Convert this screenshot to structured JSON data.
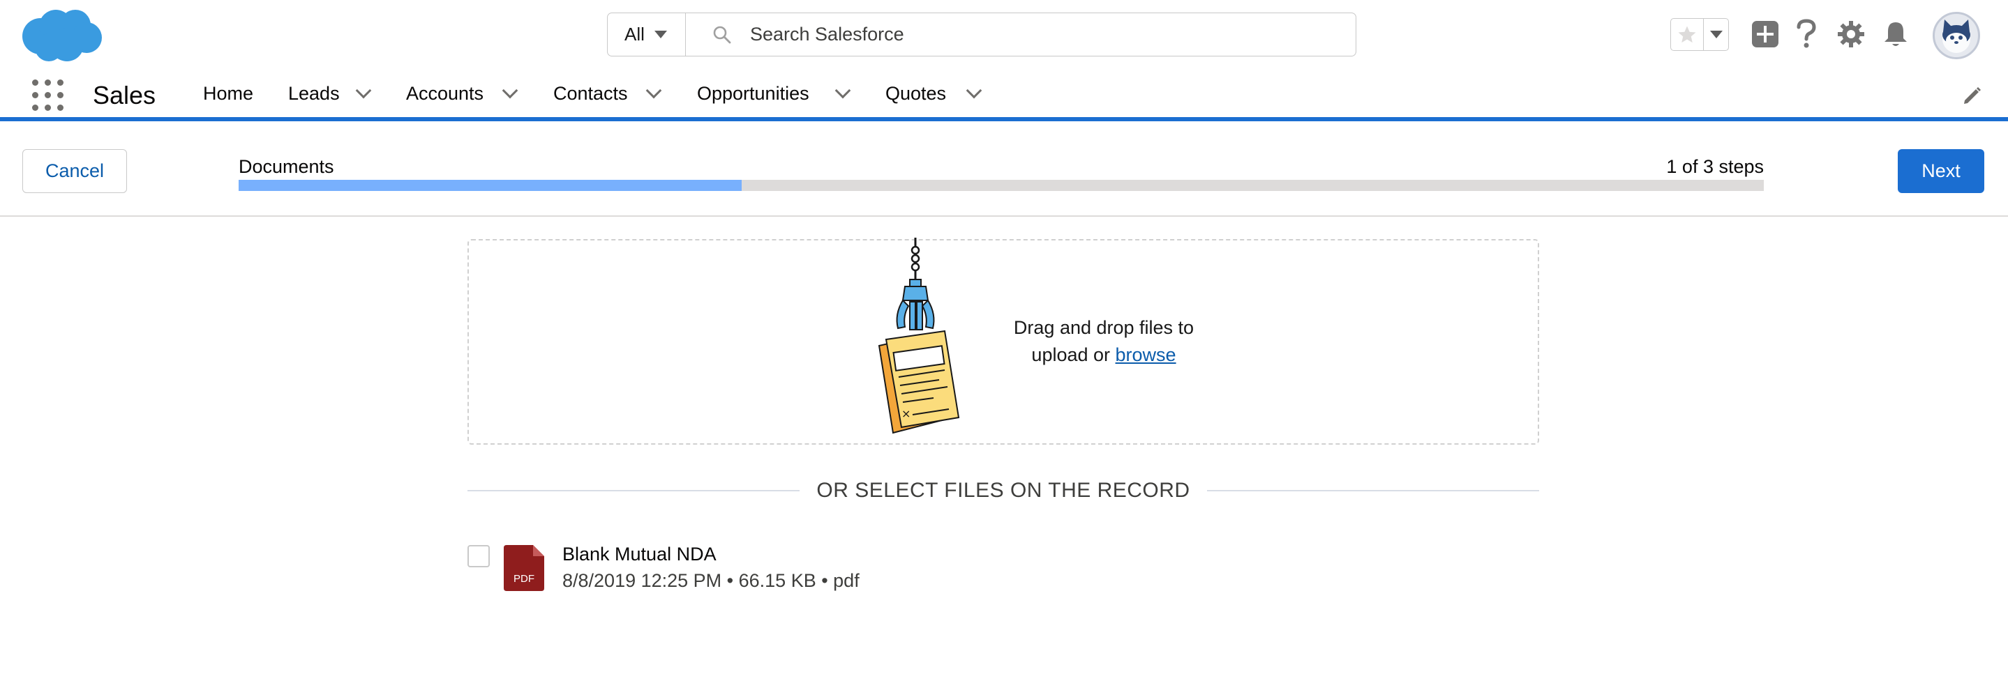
{
  "header": {
    "logo_name": "salesforce-cloud-logo",
    "search": {
      "scope": "All",
      "placeholder": "Search Salesforce",
      "value": ""
    },
    "icons": [
      "star-icon",
      "chevron-down-icon",
      "plus-icon",
      "question-icon",
      "gear-icon",
      "bell-icon",
      "avatar"
    ]
  },
  "nav": {
    "app_name": "Sales",
    "items": [
      {
        "label": "Home",
        "has_menu": false
      },
      {
        "label": "Leads",
        "has_menu": true
      },
      {
        "label": "Accounts",
        "has_menu": true
      },
      {
        "label": "Contacts",
        "has_menu": true
      },
      {
        "label": "Opportunities",
        "has_menu": true
      },
      {
        "label": "Quotes",
        "has_menu": true
      }
    ]
  },
  "wizard": {
    "cancel_label": "Cancel",
    "step_title": "Documents",
    "step_count": "1 of 3 steps",
    "progress_fraction": 0.33,
    "next_label": "Next"
  },
  "dropzone": {
    "text_line1": "Drag and drop files to",
    "text_line2_prefix": "upload or",
    "browse_label": "browse"
  },
  "divider_label": "OR SELECT FILES ON THE RECORD",
  "files": [
    {
      "name": "Blank Mutual NDA",
      "meta": "8/8/2019 12:25 PM • 66.15 KB • pdf",
      "icon_text": "PDF",
      "checked": false
    }
  ],
  "colors": {
    "brand_blue": "#1b6ed1",
    "link_blue": "#0b5cab",
    "progress_fill": "#78b0fd",
    "pdf_red": "#8f1d1d",
    "logo_blue": "#3a9be0"
  }
}
